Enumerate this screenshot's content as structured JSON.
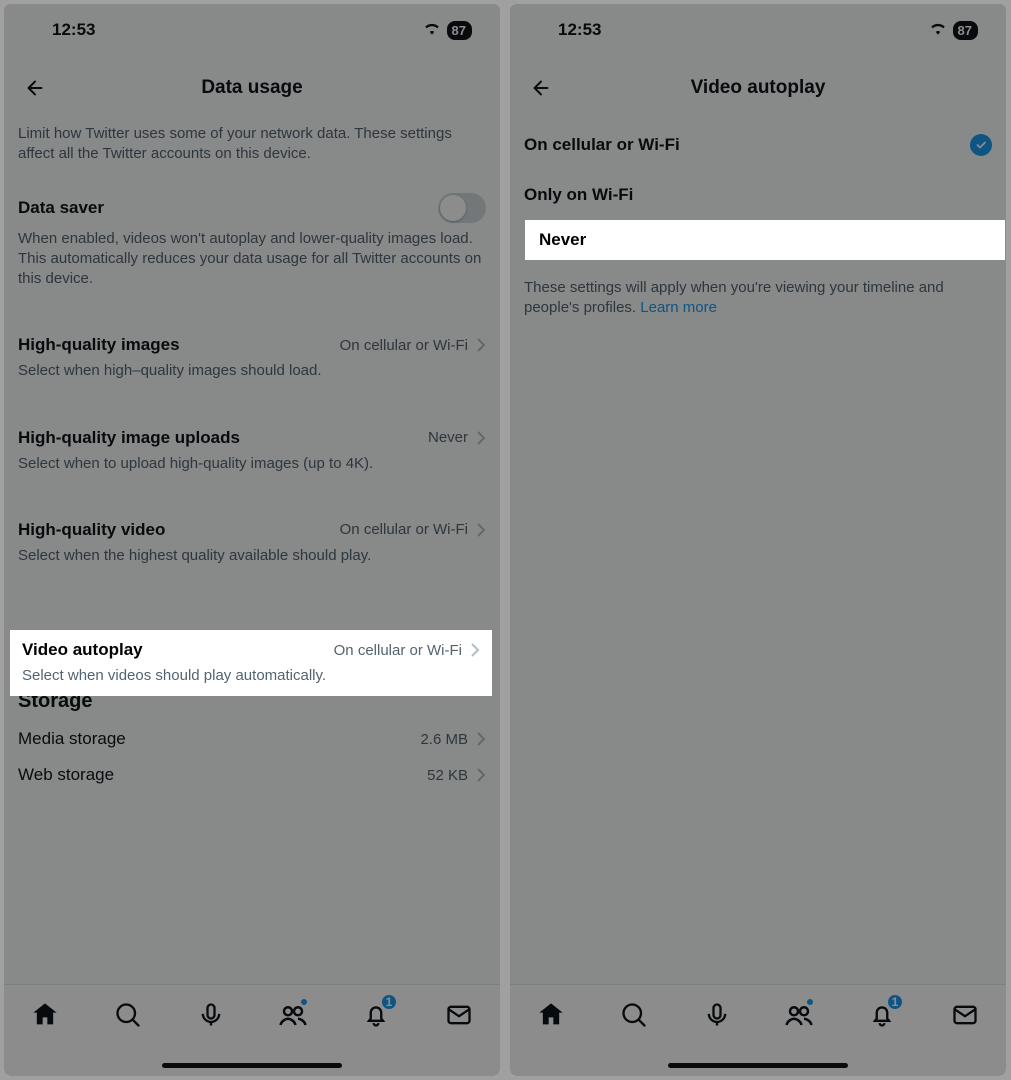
{
  "status": {
    "time": "12:53",
    "wifi_icon": "wifi",
    "battery": "87"
  },
  "left": {
    "title": "Data usage",
    "intro": "Limit how Twitter uses some of your network data. These settings affect all the Twitter accounts on this device.",
    "data_saver": {
      "label": "Data saver",
      "desc": "When enabled, videos won't autoplay and lower-quality images load. This automatically reduces your data usage for all Twitter accounts on this device.",
      "on": false
    },
    "rows": [
      {
        "label": "High-quality images",
        "value": "On cellular or Wi-Fi",
        "desc": "Select when high–quality images should load."
      },
      {
        "label": "High-quality image uploads",
        "value": "Never",
        "desc": "Select when to upload high-quality images (up to 4K)."
      },
      {
        "label": "High-quality video",
        "value": "On cellular or Wi-Fi",
        "desc": "Select when the highest quality available should play."
      },
      {
        "label": "Video autoplay",
        "value": "On cellular or Wi-Fi",
        "desc": "Select when videos should play automatically."
      }
    ],
    "storage": {
      "title": "Storage",
      "items": [
        {
          "label": "Media storage",
          "value": "2.6 MB"
        },
        {
          "label": "Web storage",
          "value": "52 KB"
        }
      ]
    }
  },
  "right": {
    "title": "Video autoplay",
    "options": [
      {
        "label": "On cellular or Wi-Fi",
        "selected": true
      },
      {
        "label": "Only on Wi-Fi",
        "selected": false
      },
      {
        "label": "Never",
        "selected": false
      }
    ],
    "footer_note": "These settings will apply when you're viewing your timeline and people's profiles. ",
    "footer_link": "Learn more"
  },
  "tabs": {
    "notifications_count": "1"
  }
}
